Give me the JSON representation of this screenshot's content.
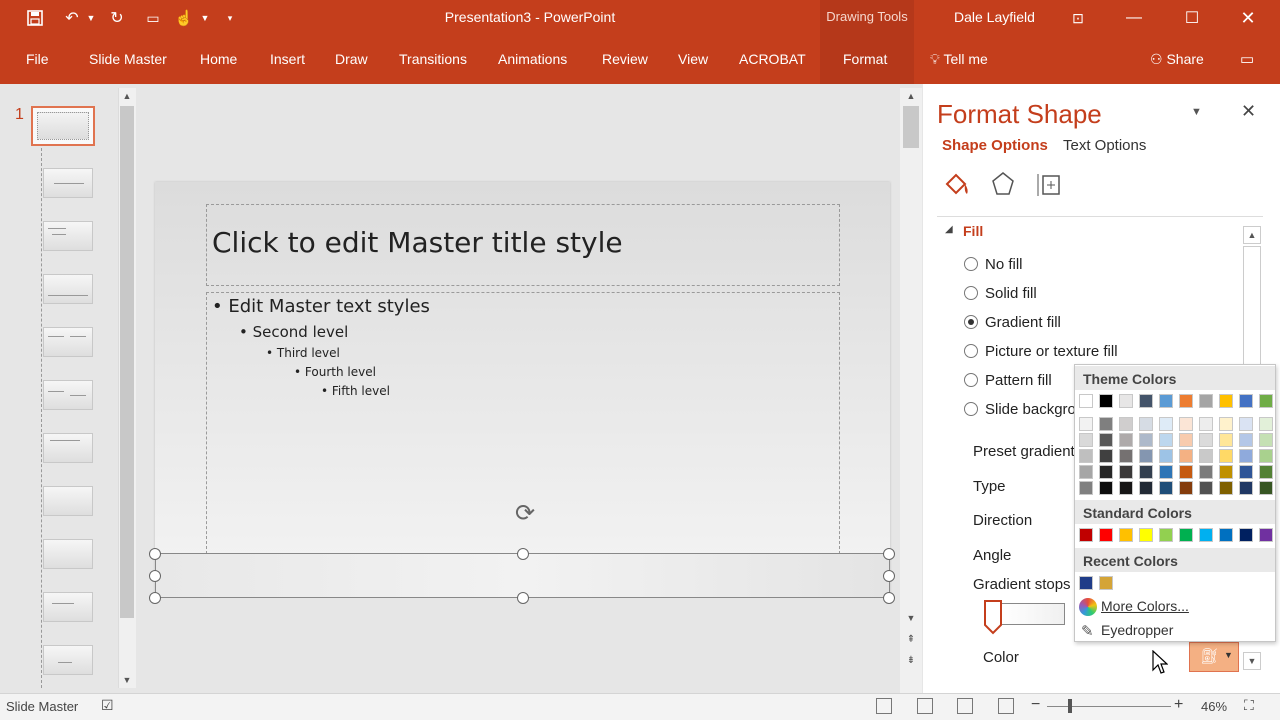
{
  "app": {
    "window_title": "Presentation3 - PowerPoint",
    "context_label": "Drawing Tools",
    "user": "Dale Layfield",
    "accent": "#c43e1c"
  },
  "tabs": [
    "File",
    "Slide Master",
    "Home",
    "Insert",
    "Draw",
    "Transitions",
    "Animations",
    "Review",
    "View",
    "ACROBAT",
    "Format"
  ],
  "tell_me": "Tell me",
  "share": "Share",
  "thumbnails": {
    "first_number": "1"
  },
  "slide": {
    "title": "Click to edit Master title style",
    "levels": [
      "Edit Master text styles",
      "Second level",
      "Third level",
      "Fourth level",
      "Fifth level"
    ]
  },
  "format_pane": {
    "title": "Format Shape",
    "tab_shape": "Shape Options",
    "tab_text": "Text Options",
    "section_fill": "Fill",
    "fill_options": [
      "No fill",
      "Solid fill",
      "Gradient fill",
      "Picture or texture fill",
      "Pattern fill",
      "Slide backgro"
    ],
    "selected_fill": "Gradient fill",
    "properties": [
      "Preset gradient",
      "Type",
      "Direction",
      "Angle",
      "Gradient stops",
      "Color"
    ]
  },
  "color_popup": {
    "theme_header": "Theme Colors",
    "standard_header": "Standard Colors",
    "recent_header": "Recent Colors",
    "more_colors": "More Colors...",
    "eyedropper": "Eyedropper",
    "theme_top": [
      "#ffffff",
      "#000000",
      "#e7e6e6",
      "#44546a",
      "#5b9bd5",
      "#ed7d31",
      "#a5a5a5",
      "#ffc000",
      "#4472c4",
      "#70ad47"
    ],
    "theme_columns": [
      [
        "#f2f2f2",
        "#d9d9d9",
        "#bfbfbf",
        "#a6a6a6",
        "#808080"
      ],
      [
        "#7f7f7f",
        "#595959",
        "#404040",
        "#262626",
        "#0d0d0d"
      ],
      [
        "#d0cece",
        "#aeaaaa",
        "#757171",
        "#3a3838",
        "#171616"
      ],
      [
        "#d6dce4",
        "#adb9ca",
        "#8496b0",
        "#333f4f",
        "#222a35"
      ],
      [
        "#deebf7",
        "#bdd7ee",
        "#9dc3e6",
        "#2e75b6",
        "#1f4e79"
      ],
      [
        "#fbe5d6",
        "#f8cbad",
        "#f4b183",
        "#c55a11",
        "#843c0c"
      ],
      [
        "#ededed",
        "#dbdbdb",
        "#c9c9c9",
        "#7b7b7b",
        "#525252"
      ],
      [
        "#fff2cc",
        "#ffe699",
        "#ffd966",
        "#bf9000",
        "#7f6000"
      ],
      [
        "#dae3f3",
        "#b4c7e7",
        "#8faadc",
        "#2f5597",
        "#203864"
      ],
      [
        "#e2f0d9",
        "#c5e0b4",
        "#a9d18e",
        "#538135",
        "#375623"
      ]
    ],
    "standard": [
      "#c00000",
      "#ff0000",
      "#ffc000",
      "#ffff00",
      "#92d050",
      "#00b050",
      "#00b0f0",
      "#0070c0",
      "#002060",
      "#7030a0"
    ],
    "recent": [
      "#1f3c88",
      "#d4a437"
    ]
  },
  "status": {
    "view": "Slide Master",
    "zoom": "46%",
    "zoom_level_fraction": 0.46
  }
}
